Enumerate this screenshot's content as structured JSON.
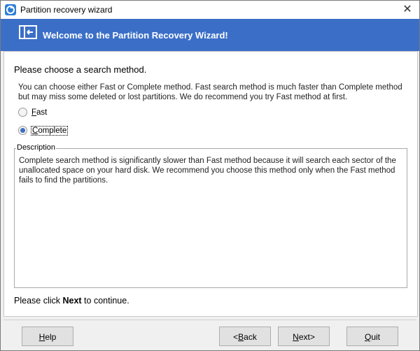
{
  "window": {
    "title": "Partition recovery wizard",
    "close_glyph": "✕"
  },
  "banner": {
    "title": "Welcome to the Partition Recovery Wizard!",
    "icon": "partition-icon"
  },
  "content": {
    "heading": "Please choose a search method.",
    "intro": "You can choose either Fast or Complete method. Fast search method is much faster than Complete method but may miss some deleted or lost partitions. We do recommend you try Fast method at first.",
    "options": [
      {
        "first": "F",
        "rest": "ast",
        "selected": false
      },
      {
        "first": "C",
        "rest": "omplete",
        "selected": true
      }
    ],
    "description": {
      "legend": "Description",
      "text": "Complete search method is significantly slower than Fast method because it will search each sector of the unallocated space on your hard disk. We recommend you choose this method only when the Fast method fails to find the partitions."
    },
    "footer": {
      "prefix": "Please click ",
      "bold": "Next",
      "suffix": " to continue."
    }
  },
  "buttons": {
    "help": {
      "mn": "H",
      "rest": "elp"
    },
    "back": {
      "pre": "<",
      "mn": "B",
      "rest": "ack"
    },
    "next": {
      "mn": "N",
      "rest": "ext>"
    },
    "quit": {
      "mn": "Q",
      "rest": "uit"
    }
  },
  "colors": {
    "banner": "#3b6fc7",
    "radio_dot": "#3d6fbf"
  }
}
